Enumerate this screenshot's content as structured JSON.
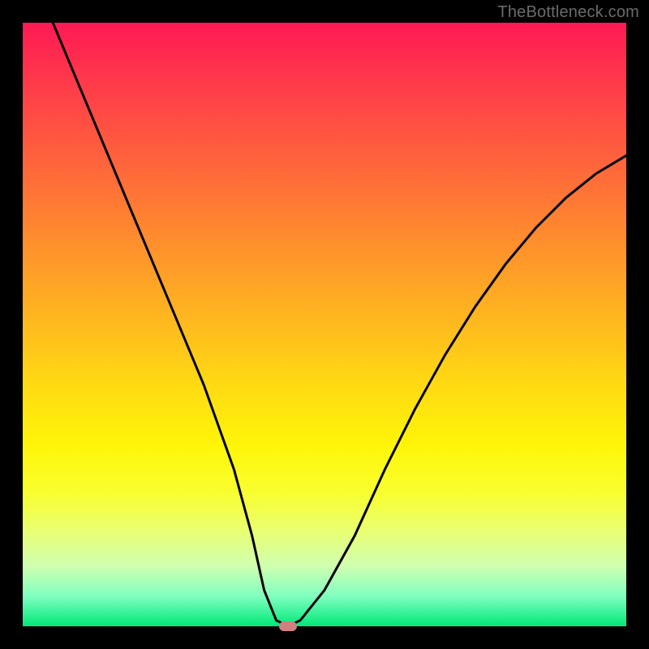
{
  "watermark": "TheBottleneck.com",
  "chart_data": {
    "type": "line",
    "title": "",
    "xlabel": "",
    "ylabel": "",
    "xlim": [
      0,
      100
    ],
    "ylim": [
      0,
      100
    ],
    "grid": false,
    "legend": false,
    "series": [
      {
        "name": "curve",
        "x": [
          5,
          10,
          15,
          20,
          25,
          30,
          35,
          38,
          40,
          42,
          44,
          46,
          50,
          55,
          60,
          65,
          70,
          75,
          80,
          85,
          90,
          95,
          100
        ],
        "values": [
          100,
          88,
          76,
          64,
          52,
          40,
          26,
          15,
          6,
          1,
          0,
          1,
          6,
          15,
          26,
          36,
          45,
          53,
          60,
          66,
          71,
          75,
          78
        ]
      }
    ],
    "marker": {
      "x": 44,
      "y": 0
    },
    "colors": {
      "curve": "#000000",
      "marker": "#d08080",
      "background_top": "#ff1a55",
      "background_bottom": "#00e878"
    }
  }
}
